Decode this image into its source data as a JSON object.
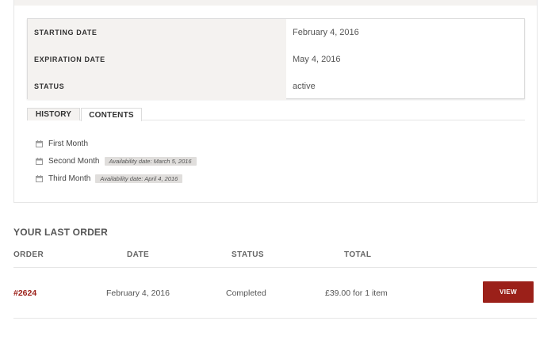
{
  "subscription": {
    "details": [
      {
        "label": "STARTING DATE",
        "value": "February 4, 2016"
      },
      {
        "label": "EXPIRATION DATE",
        "value": "May 4, 2016"
      },
      {
        "label": "STATUS",
        "value": "active"
      }
    ],
    "tabs": [
      {
        "label": "HISTORY",
        "active": false
      },
      {
        "label": "CONTENTS",
        "active": true
      }
    ],
    "contents": [
      {
        "title": "First Month",
        "availability": ""
      },
      {
        "title": "Second Month",
        "availability": "Availability date: March 5, 2016"
      },
      {
        "title": "Third Month",
        "availability": "Availability date: April 4, 2016"
      }
    ]
  },
  "last_order": {
    "title": "YOUR LAST ORDER",
    "columns": [
      "ORDER",
      "DATE",
      "STATUS",
      "TOTAL"
    ],
    "row": {
      "order": "#2624",
      "date": "February 4, 2016",
      "status": "Completed",
      "total": "£39.00 for 1 item",
      "action": "VIEW"
    }
  },
  "colors": {
    "accent": "#9b2019",
    "label_bg": "#f4f2f0",
    "border": "#e6e6e6"
  },
  "icons": {
    "content_item": "calendar-icon"
  }
}
